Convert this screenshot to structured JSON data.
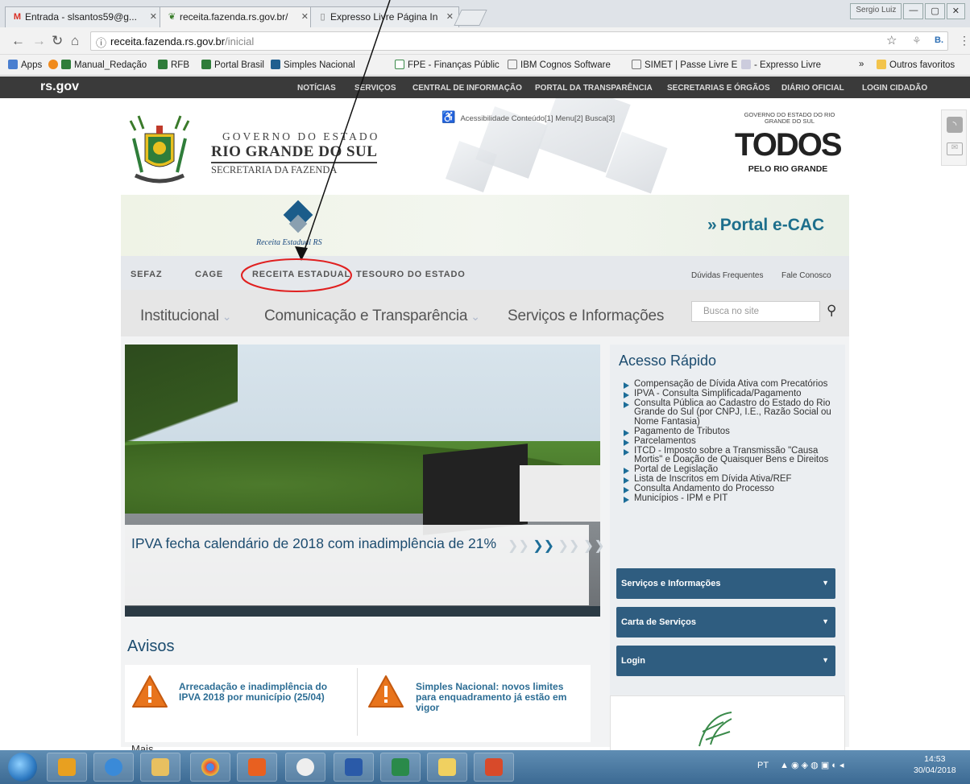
{
  "browser": {
    "tabs": [
      {
        "label": "Entrada - slsantos59@g...",
        "icon": "gmail-icon"
      },
      {
        "label": "receita.fazenda.rs.gov.br/",
        "icon": "site-icon"
      },
      {
        "label": "Expresso Livre Página In",
        "icon": "page-icon"
      }
    ],
    "window_user": "Sergio Luiz",
    "url_host": "receita.fazenda.rs.gov.br",
    "url_path": "/inicial",
    "bookmarks": [
      "Apps",
      "Manual_Redação",
      "RFB",
      "Portal Brasil",
      "Simples Nacional",
      "FPE - Finanças Públic",
      "IBM Cognos Software",
      "SIMET | Passe Livre E",
      "- Expresso Livre"
    ],
    "bookmarks_more": "»",
    "other_bookmarks": "Outros favoritos"
  },
  "govbar": {
    "logo": "rs.gov",
    "links": [
      "NOTÍCIAS",
      "SERVIÇOS",
      "CENTRAL DE INFORMAÇÃO",
      "PORTAL DA TRANSPARÊNCIA",
      "SECRETARIAS E ÓRGÃOS",
      "DIÁRIO OFICIAL",
      "LOGIN CIDADÃO"
    ]
  },
  "header": {
    "line1": "GOVERNO DO ESTADO",
    "line2": "RIO GRANDE DO SUL",
    "line3": "SECRETARIA DA FAZENDA",
    "accessibility": "Acessibilidade  Conteúdo[1]  Menu[2]  Busca[3]",
    "todos_top": "GOVERNO DO ESTADO DO RIO GRANDE DO SUL",
    "todos_main": "TODOS",
    "todos_sub": "PELO RIO GRANDE"
  },
  "banner": {
    "receita_label": "Receita Estadual RS",
    "ecac": "Portal e-CAC"
  },
  "subnav": {
    "items": [
      "SEFAZ",
      "CAGE",
      "RECEITA ESTADUAL",
      "TESOURO DO ESTADO"
    ],
    "right": [
      "Dúvidas Frequentes",
      "Fale Conosco"
    ]
  },
  "mainnav": {
    "items": [
      "Institucional",
      "Comunicação e Transparência",
      "Serviços e Informações"
    ],
    "search_placeholder": "Busca no site"
  },
  "hero": {
    "caption": "IPVA fecha calendário de 2018 com inadimplência de 21%"
  },
  "avisos": {
    "title": "Avisos",
    "items": [
      "Arrecadação e inadimplência do IPVA 2018 por município (25/04)",
      "Simples Nacional: novos limites para enquadramento já estão em vigor"
    ],
    "more": "Mais..."
  },
  "acesso_rapido": {
    "title": "Acesso Rápido",
    "links": [
      "Compensação de Dívida Ativa com Precatórios",
      "IPVA - Consulta Simplificada/Pagamento",
      "Consulta Pública ao Cadastro do Estado do Rio Grande do Sul (por CNPJ, I.E., Razão Social ou Nome Fantasia)",
      "Pagamento de Tributos",
      "Parcelamentos",
      "ITCD - Imposto sobre a Transmissão \"Causa Mortis\" e Doação de Quaisquer Bens e Direitos",
      "Portal de Legislação",
      "Lista de Inscritos em Dívida Ativa/REF",
      "Consulta Andamento do Processo",
      "Municípios - IPM e PIT"
    ],
    "dropdowns": [
      "Serviços e Informações",
      "Carta de Serviços",
      "Login"
    ]
  },
  "taskbar": {
    "lang": "PT",
    "time": "14:53",
    "date": "30/04/2018"
  },
  "colors": {
    "accent": "#1c4c6f",
    "annotation": "#e02020",
    "govbar": "#3a3a3a"
  }
}
